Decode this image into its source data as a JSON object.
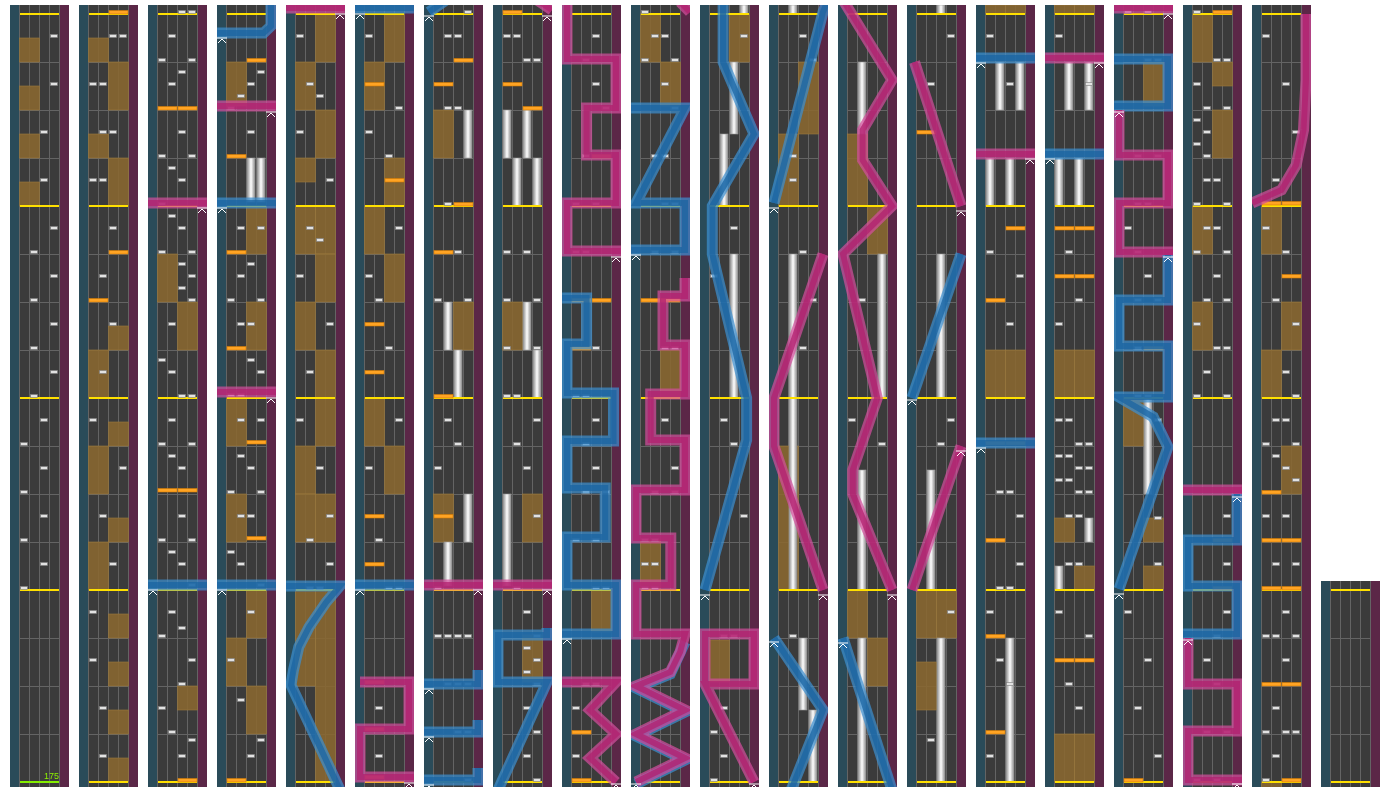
{
  "chart": {
    "columns": [
      {
        "kind": "full",
        "tempo_marker": "175"
      },
      {
        "kind": "full"
      },
      {
        "kind": "full"
      },
      {
        "kind": "full"
      },
      {
        "kind": "full"
      },
      {
        "kind": "full"
      },
      {
        "kind": "full"
      },
      {
        "kind": "full"
      },
      {
        "kind": "full"
      },
      {
        "kind": "full"
      },
      {
        "kind": "full"
      },
      {
        "kind": "full"
      },
      {
        "kind": "full"
      },
      {
        "kind": "full"
      },
      {
        "kind": "full"
      },
      {
        "kind": "full"
      },
      {
        "kind": "full"
      },
      {
        "kind": "full"
      },
      {
        "kind": "full"
      },
      {
        "kind": "end"
      }
    ]
  }
}
